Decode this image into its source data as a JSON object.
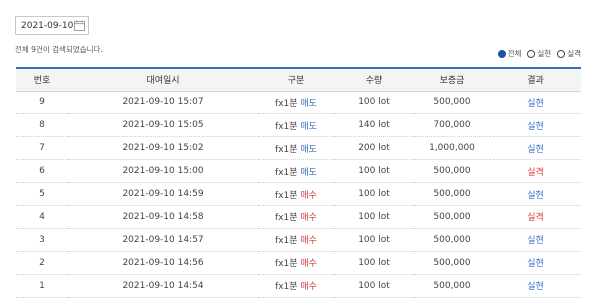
{
  "search": {
    "date_value": "2021-09-10"
  },
  "summary": {
    "count_text": "전체 9건이 검색되었습니다."
  },
  "filters": [
    {
      "label": "전체",
      "checked": true
    },
    {
      "label": "실현",
      "checked": false
    },
    {
      "label": "실격",
      "checked": false
    }
  ],
  "table": {
    "headers": [
      "번호",
      "대여일시",
      "구분",
      "수량",
      "보증금",
      "결과"
    ],
    "rows": [
      {
        "no": "9",
        "datetime": "2021-09-10 15:07",
        "product": "fx1분",
        "side": "매도",
        "side_kind": "sell",
        "qty": "100 lot",
        "deposit": "500,000",
        "result": "실현",
        "result_kind": "ok"
      },
      {
        "no": "8",
        "datetime": "2021-09-10 15:05",
        "product": "fx1분",
        "side": "매도",
        "side_kind": "sell",
        "qty": "140 lot",
        "deposit": "700,000",
        "result": "실현",
        "result_kind": "ok"
      },
      {
        "no": "7",
        "datetime": "2021-09-10 15:02",
        "product": "fx1분",
        "side": "매도",
        "side_kind": "sell",
        "qty": "200 lot",
        "deposit": "1,000,000",
        "result": "실현",
        "result_kind": "ok"
      },
      {
        "no": "6",
        "datetime": "2021-09-10 15:00",
        "product": "fx1분",
        "side": "매도",
        "side_kind": "sell",
        "qty": "100 lot",
        "deposit": "500,000",
        "result": "실격",
        "result_kind": "fail"
      },
      {
        "no": "5",
        "datetime": "2021-09-10 14:59",
        "product": "fx1분",
        "side": "매수",
        "side_kind": "buy",
        "qty": "100 lot",
        "deposit": "500,000",
        "result": "실현",
        "result_kind": "ok"
      },
      {
        "no": "4",
        "datetime": "2021-09-10 14:58",
        "product": "fx1분",
        "side": "매수",
        "side_kind": "buy",
        "qty": "100 lot",
        "deposit": "500,000",
        "result": "실격",
        "result_kind": "fail"
      },
      {
        "no": "3",
        "datetime": "2021-09-10 14:57",
        "product": "fx1분",
        "side": "매수",
        "side_kind": "buy",
        "qty": "100 lot",
        "deposit": "500,000",
        "result": "실현",
        "result_kind": "ok"
      },
      {
        "no": "2",
        "datetime": "2021-09-10 14:56",
        "product": "fx1분",
        "side": "매수",
        "side_kind": "buy",
        "qty": "100 lot",
        "deposit": "500,000",
        "result": "실현",
        "result_kind": "ok"
      },
      {
        "no": "1",
        "datetime": "2021-09-10 14:54",
        "product": "fx1분",
        "side": "매수",
        "side_kind": "buy",
        "qty": "100 lot",
        "deposit": "500,000",
        "result": "실현",
        "result_kind": "ok"
      }
    ]
  },
  "colors": {
    "header_border": "#3b6db5",
    "sell": "#3a6fc4",
    "buy": "#d23b3b",
    "ok": "#3a6fc4",
    "fail": "#d23b3b"
  },
  "icons": {
    "date_picker": "calendar-icon"
  }
}
